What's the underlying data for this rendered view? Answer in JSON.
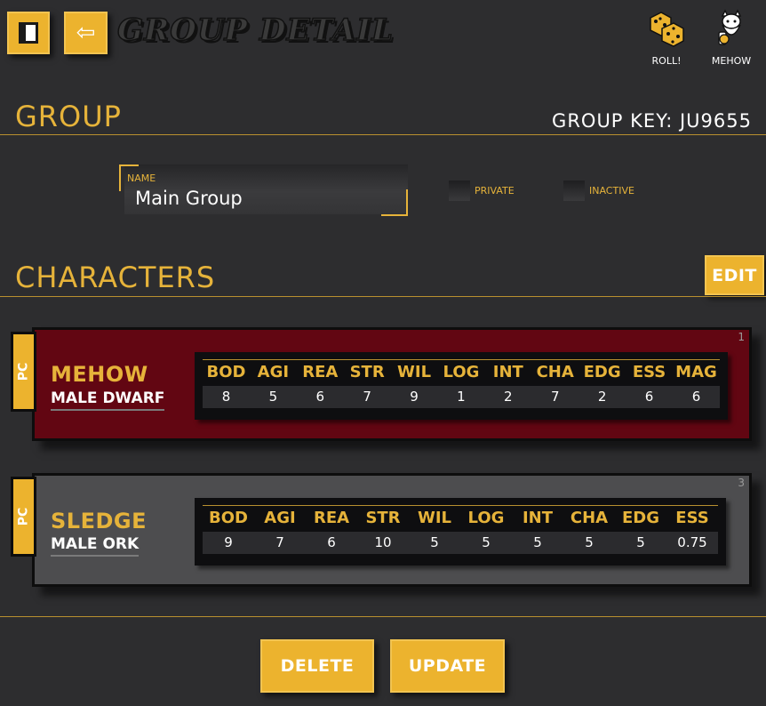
{
  "header": {
    "title": "GROUP DETAIL",
    "back_glyph": "⇦",
    "roll_label": "ROLL!",
    "profile_label": "MEHOW"
  },
  "group": {
    "section_title": "GROUP",
    "group_key": "GROUP KEY: JU9655",
    "name_label": "NAME",
    "name_value": "Main Group",
    "private_label": "PRIVATE",
    "inactive_label": "INACTIVE"
  },
  "characters": {
    "section_title": "CHARACTERS",
    "edit_label": "EDIT",
    "list": [
      {
        "index": "1",
        "tab": "PC",
        "name": "MEHOW",
        "subtitle": "MALE DWARF",
        "color": "#620612",
        "stats": [
          {
            "k": "BOD",
            "v": "8"
          },
          {
            "k": "AGI",
            "v": "5"
          },
          {
            "k": "REA",
            "v": "6"
          },
          {
            "k": "STR",
            "v": "7"
          },
          {
            "k": "WIL",
            "v": "9"
          },
          {
            "k": "LOG",
            "v": "1"
          },
          {
            "k": "INT",
            "v": "2"
          },
          {
            "k": "CHA",
            "v": "7"
          },
          {
            "k": "EDG",
            "v": "2"
          },
          {
            "k": "ESS",
            "v": "6"
          },
          {
            "k": "MAG",
            "v": "6"
          }
        ]
      },
      {
        "index": "3",
        "tab": "PC",
        "name": "SLEDGE",
        "subtitle": "MALE ORK",
        "color": "#4d4d4f",
        "stats": [
          {
            "k": "BOD",
            "v": "9"
          },
          {
            "k": "AGI",
            "v": "7"
          },
          {
            "k": "REA",
            "v": "6"
          },
          {
            "k": "STR",
            "v": "10"
          },
          {
            "k": "WIL",
            "v": "5"
          },
          {
            "k": "LOG",
            "v": "5"
          },
          {
            "k": "INT",
            "v": "5"
          },
          {
            "k": "CHA",
            "v": "5"
          },
          {
            "k": "EDG",
            "v": "5"
          },
          {
            "k": "ESS",
            "v": "0.75"
          }
        ]
      }
    ]
  },
  "actions": {
    "delete_label": "DELETE",
    "update_label": "UPDATE"
  },
  "colors": {
    "accent": "#ecb32e",
    "background": "#2d2d2f"
  }
}
